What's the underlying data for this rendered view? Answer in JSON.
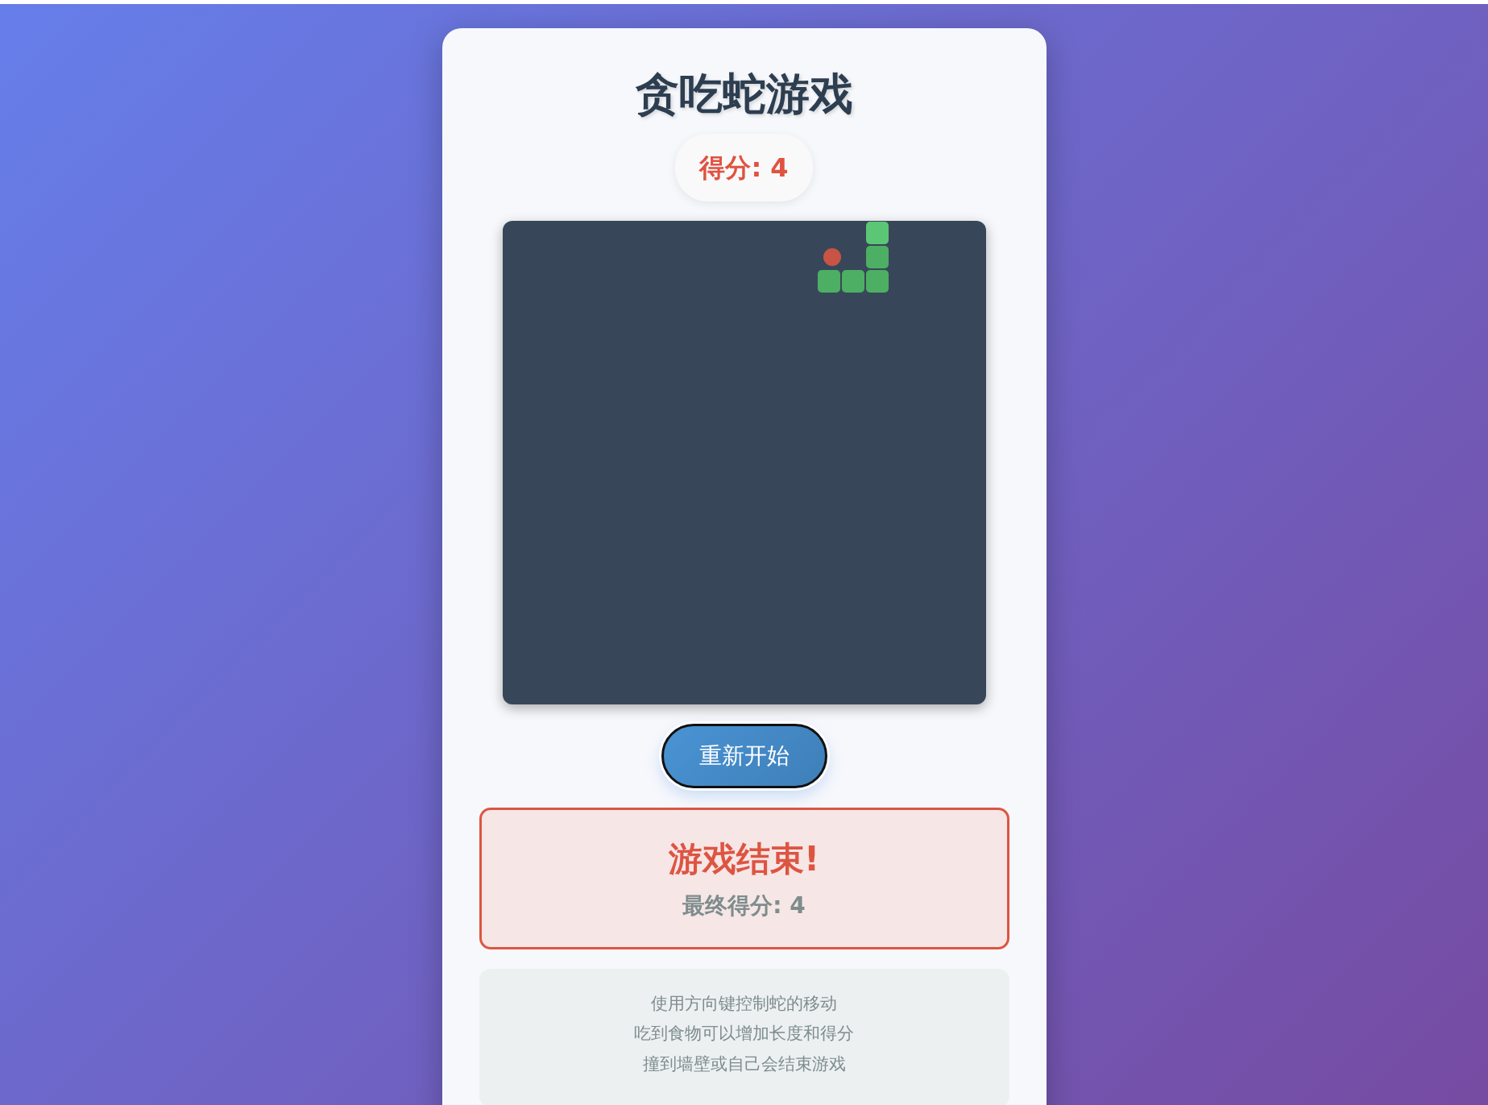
{
  "title": "贪吃蛇游戏",
  "score": "得分: 4",
  "restart_button": "重新开始",
  "game_over": {
    "title": "游戏结束!",
    "final_score": "最终得分: 4"
  },
  "instructions": [
    "使用方向键控制蛇的移动",
    "吃到食物可以增加长度和得分",
    "撞到墙壁或自己会结束游戏"
  ]
}
